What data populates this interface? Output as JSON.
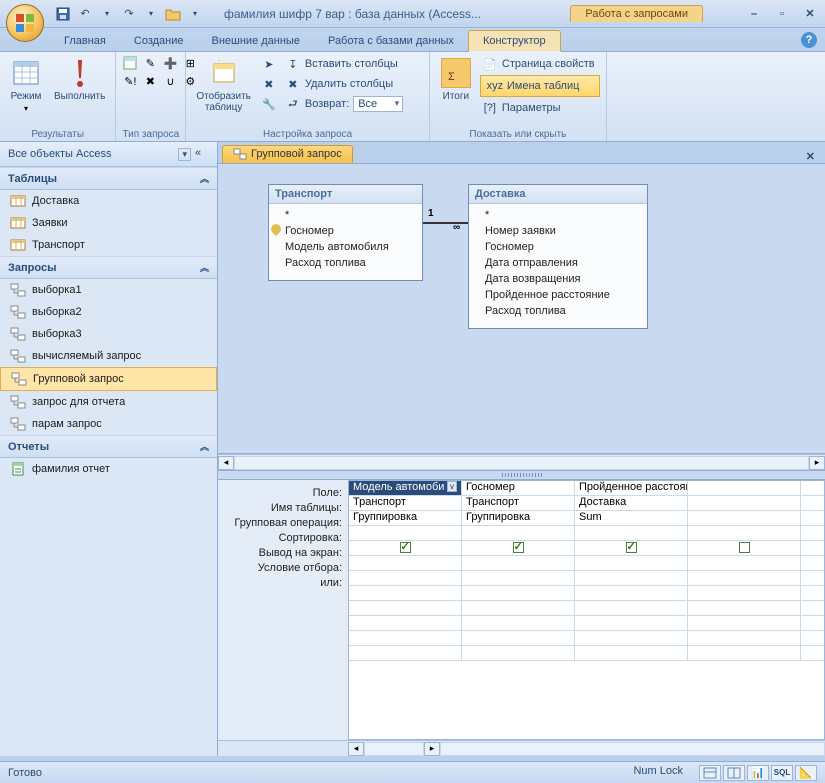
{
  "title": "фамилия шифр 7 вар : база данных (Access...",
  "context_tab_title": "Работа с запросами",
  "ribbon_tabs": {
    "home": "Главная",
    "create": "Создание",
    "external": "Внешние данные",
    "dbtools": "Работа с базами данных",
    "design": "Конструктор"
  },
  "ribbon": {
    "results": {
      "label": "Результаты",
      "view": "Режим",
      "run": "Выполнить"
    },
    "qtype": {
      "label": "Тип запроса"
    },
    "setup": {
      "label": "Настройка запроса",
      "show_table": "Отобразить\nтаблицу",
      "insert_cols": "Вставить столбцы",
      "delete_cols": "Удалить столбцы",
      "return": "Возврат:",
      "return_value": "Все"
    },
    "showhide": {
      "label": "Показать или скрыть",
      "totals": "Итоги",
      "prop_page": "Страница свойств",
      "table_names": "Имена таблиц",
      "params": "Параметры"
    }
  },
  "nav": {
    "header": "Все объекты Access",
    "cat_tables": "Таблицы",
    "tables": [
      "Доставка",
      "Заявки",
      "Транспорт"
    ],
    "cat_queries": "Запросы",
    "queries": [
      "выборка1",
      "выборка2",
      "выборка3",
      "вычисляемый запрос",
      "Групповой запрос",
      "запрос для отчета",
      "парам запрос"
    ],
    "cat_reports": "Отчеты",
    "reports": [
      "фамилия отчет"
    ],
    "selected_query": "Групповой запрос"
  },
  "doc_tab": "Групповой запрос",
  "diagram": {
    "t1": {
      "title": "Транспорт",
      "fields": [
        "*",
        "Госномер",
        "Модель автомобиля",
        "Расход топлива"
      ],
      "key_index": 1
    },
    "t2": {
      "title": "Доставка",
      "fields": [
        "*",
        "Номер заявки",
        "Госномер",
        "Дата отправления",
        "Дата возвращения",
        "Пройденное расстояние",
        "Расход топлива"
      ]
    },
    "rel": {
      "left": "1",
      "right": "∞"
    }
  },
  "grid": {
    "rows": [
      "Поле:",
      "Имя таблицы:",
      "Групповая операция:",
      "Сортировка:",
      "Вывод на экран:",
      "Условие отбора:",
      "или:"
    ],
    "cols": [
      {
        "field": "Модель автомоби",
        "table": "Транспорт",
        "op": "Группировка",
        "show": true
      },
      {
        "field": "Госномер",
        "table": "Транспорт",
        "op": "Группировка",
        "show": true
      },
      {
        "field": "Пройденное расстояние",
        "table": "Доставка",
        "op": "Sum",
        "show": true
      },
      {
        "field": "",
        "table": "",
        "op": "",
        "show": false
      }
    ]
  },
  "status": {
    "ready": "Готово",
    "numlock": "Num Lock"
  }
}
